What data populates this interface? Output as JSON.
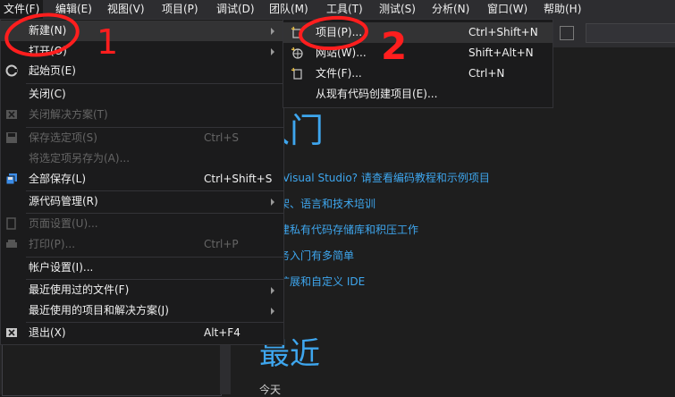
{
  "menubar": {
    "items": [
      {
        "label": "文件(F)"
      },
      {
        "label": "编辑(E)"
      },
      {
        "label": "视图(V)"
      },
      {
        "label": "项目(P)"
      },
      {
        "label": "调试(D)"
      },
      {
        "label": "团队(M)"
      },
      {
        "label": "工具(T)"
      },
      {
        "label": "测试(S)"
      },
      {
        "label": "分析(N)"
      },
      {
        "label": "窗口(W)"
      },
      {
        "label": "帮助(H)"
      }
    ]
  },
  "file_menu": {
    "items": [
      {
        "label": "新建(N)",
        "shortcut": "",
        "submenu": true,
        "enabled": true,
        "icon": "none"
      },
      {
        "label": "打开(O)",
        "shortcut": "",
        "submenu": true,
        "enabled": true,
        "icon": "none"
      },
      {
        "label": "起始页(E)",
        "shortcut": "",
        "submenu": false,
        "enabled": true,
        "icon": "start-page-icon"
      },
      {
        "label": "关闭(C)",
        "shortcut": "",
        "submenu": false,
        "enabled": true,
        "icon": "none"
      },
      {
        "label": "关闭解决方案(T)",
        "shortcut": "",
        "submenu": false,
        "enabled": false,
        "icon": "close-solution-icon"
      },
      {
        "label": "保存选定项(S)",
        "shortcut": "Ctrl+S",
        "submenu": false,
        "enabled": false,
        "icon": "save-icon"
      },
      {
        "label": "将选定项另存为(A)...",
        "shortcut": "",
        "submenu": false,
        "enabled": false,
        "icon": "none"
      },
      {
        "label": "全部保存(L)",
        "shortcut": "Ctrl+Shift+S",
        "submenu": false,
        "enabled": true,
        "icon": "save-all-icon"
      },
      {
        "label": "源代码管理(R)",
        "shortcut": "",
        "submenu": true,
        "enabled": true,
        "icon": "none"
      },
      {
        "label": "页面设置(U)...",
        "shortcut": "",
        "submenu": false,
        "enabled": false,
        "icon": "page-setup-icon"
      },
      {
        "label": "打印(P)...",
        "shortcut": "Ctrl+P",
        "submenu": false,
        "enabled": false,
        "icon": "print-icon"
      },
      {
        "label": "帐户设置(I)...",
        "shortcut": "",
        "submenu": false,
        "enabled": true,
        "icon": "none"
      },
      {
        "label": "最近使用过的文件(F)",
        "shortcut": "",
        "submenu": true,
        "enabled": true,
        "icon": "none"
      },
      {
        "label": "最近使用的项目和解决方案(J)",
        "shortcut": "",
        "submenu": true,
        "enabled": true,
        "icon": "none"
      },
      {
        "label": "退出(X)",
        "shortcut": "Alt+F4",
        "submenu": false,
        "enabled": true,
        "icon": "exit-icon"
      }
    ]
  },
  "new_menu": {
    "items": [
      {
        "label": "项目(P)...",
        "shortcut": "Ctrl+Shift+N",
        "icon": "new-project-icon"
      },
      {
        "label": "网站(W)...",
        "shortcut": "Shift+Alt+N",
        "icon": "new-website-icon"
      },
      {
        "label": "文件(F)...",
        "shortcut": "Ctrl+N",
        "icon": "new-file-icon"
      },
      {
        "label": "从现有代码创建项目(E)...",
        "shortcut": "",
        "icon": "none"
      }
    ]
  },
  "start_page": {
    "title": "入门",
    "links": [
      "使用 Visual Studio? 请查看编码教程和示例项目",
      "新框架、语言和技术培训",
      "目创建私有代码存储库和积压工作",
      "云服务入门有多简单",
      "如何扩展和自定义 IDE"
    ],
    "recent_title": "最近",
    "today_label": "今天"
  },
  "annotations": {
    "one": "1",
    "two": "2",
    "color": "#ff1e1e"
  },
  "colors": {
    "accent": "#3ea6ee",
    "menu_bg": "#1b1b1c",
    "highlight": "#333334"
  }
}
